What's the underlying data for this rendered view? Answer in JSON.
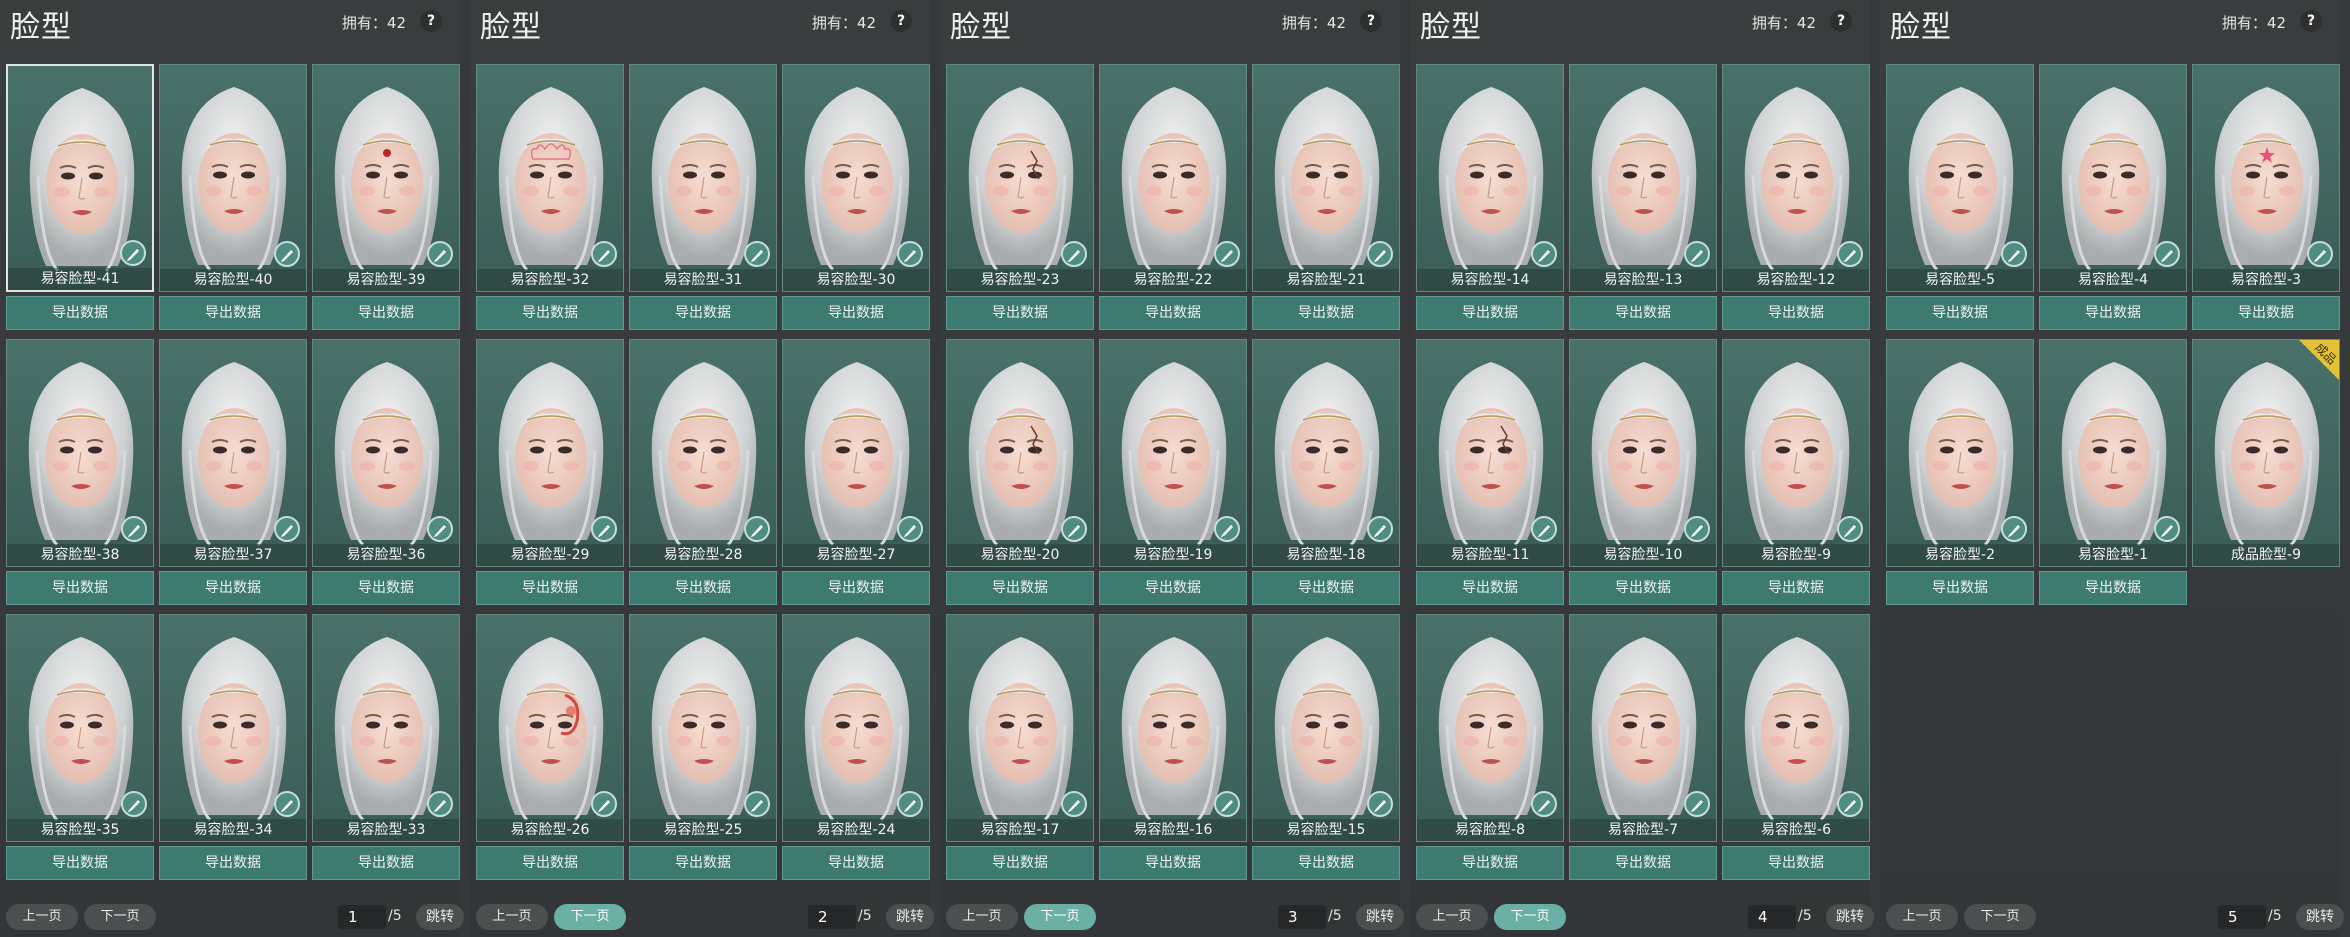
{
  "panel_title": "脸型",
  "owned_text": "拥有：42",
  "help_label": "?",
  "export_label": "导出数据",
  "prev_label": "上一页",
  "next_label": "下一页",
  "jump_label": "跳转",
  "total_pages": "/5",
  "colors": {
    "card_bg": "#49716a",
    "export_bg": "#3d7a6f",
    "active_page": "#6bb0a4",
    "bg": "#36393a"
  },
  "panels": [
    {
      "page": "1",
      "items": [
        {
          "label": "易容脸型-41",
          "selected": true,
          "mark": "none"
        },
        {
          "label": "易容脸型-40",
          "mark": "none"
        },
        {
          "label": "易容脸型-39",
          "mark": "dot"
        },
        {
          "label": "易容脸型-38",
          "mark": "none"
        },
        {
          "label": "易容脸型-37",
          "mark": "none"
        },
        {
          "label": "易容脸型-36",
          "mark": "none"
        },
        {
          "label": "易容脸型-35",
          "mark": "none"
        },
        {
          "label": "易容脸型-34",
          "mark": "none"
        },
        {
          "label": "易容脸型-33",
          "mark": "none"
        }
      ]
    },
    {
      "page": "2",
      "items": [
        {
          "label": "易容脸型-32",
          "mark": "lotus"
        },
        {
          "label": "易容脸型-31",
          "mark": "none"
        },
        {
          "label": "易容脸型-30",
          "mark": "none"
        },
        {
          "label": "易容脸型-29",
          "mark": "none"
        },
        {
          "label": "易容脸型-28",
          "mark": "none"
        },
        {
          "label": "易容脸型-27",
          "mark": "none"
        },
        {
          "label": "易容脸型-26",
          "mark": "flower"
        },
        {
          "label": "易容脸型-25",
          "mark": "none"
        },
        {
          "label": "易容脸型-24",
          "mark": "none"
        }
      ]
    },
    {
      "page": "3",
      "items": [
        {
          "label": "易容脸型-23",
          "mark": "scar"
        },
        {
          "label": "易容脸型-22",
          "mark": "none"
        },
        {
          "label": "易容脸型-21",
          "mark": "none"
        },
        {
          "label": "易容脸型-20",
          "mark": "scar"
        },
        {
          "label": "易容脸型-19",
          "mark": "none"
        },
        {
          "label": "易容脸型-18",
          "mark": "none"
        },
        {
          "label": "易容脸型-17",
          "mark": "none"
        },
        {
          "label": "易容脸型-16",
          "mark": "none"
        },
        {
          "label": "易容脸型-15",
          "mark": "none"
        }
      ]
    },
    {
      "page": "4",
      "items": [
        {
          "label": "易容脸型-14",
          "mark": "none"
        },
        {
          "label": "易容脸型-13",
          "mark": "none"
        },
        {
          "label": "易容脸型-12",
          "mark": "none"
        },
        {
          "label": "易容脸型-11",
          "mark": "scar"
        },
        {
          "label": "易容脸型-10",
          "mark": "none"
        },
        {
          "label": "易容脸型-9",
          "mark": "none"
        },
        {
          "label": "易容脸型-8",
          "mark": "none"
        },
        {
          "label": "易容脸型-7",
          "mark": "none"
        },
        {
          "label": "易容脸型-6",
          "mark": "none"
        }
      ]
    },
    {
      "page": "5",
      "items": [
        {
          "label": "易容脸型-5",
          "mark": "none"
        },
        {
          "label": "易容脸型-4",
          "mark": "none"
        },
        {
          "label": "易容脸型-3",
          "mark": "star"
        },
        {
          "label": "易容脸型-2",
          "mark": "none"
        },
        {
          "label": "易容脸型-1",
          "mark": "none"
        },
        {
          "label": "成品脸型-9",
          "mark": "none",
          "corner_tag": "成品",
          "no_export": true,
          "no_badge": true
        }
      ]
    }
  ]
}
